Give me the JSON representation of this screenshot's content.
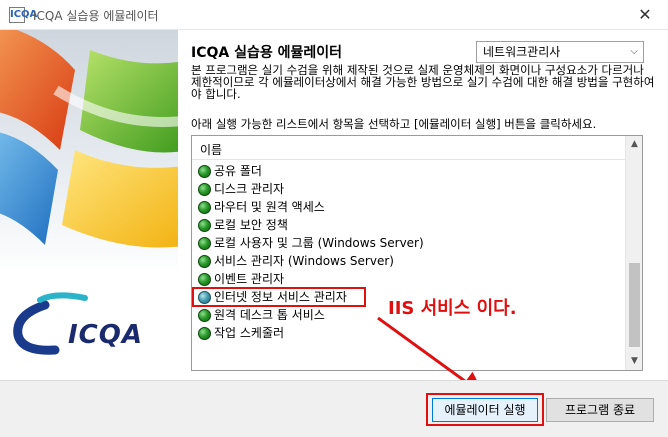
{
  "window": {
    "title": "ICQA 실습용 에뮬레이터",
    "app_icon": "ICQA",
    "close_glyph": "✕"
  },
  "brand": {
    "logo_text": "ICQA"
  },
  "header": {
    "title": "ICQA 실습용 에뮬레이터",
    "mode_select": {
      "selected": "네트워크관리사",
      "chevron": "⌵"
    }
  },
  "description": "본 프로그램은 실기 수검을 위해 제작된 것으로 실제 운영체제의 화면이나 구성요소가 다르거나 제한적이므로 각 에뮬레이터상에서 해결 가능한 방법으로 실기 수검에 대한 해결 방법을 구현하여야 합니다.",
  "instruction": "아래 실행 가능한 리스트에서 항목을 선택하고 [에뮬레이터 실행] 버튼을 클릭하세요.",
  "list": {
    "column_header": "이름",
    "items": [
      {
        "label": "공유 폴더"
      },
      {
        "label": "디스크 관리자"
      },
      {
        "label": "라우터 및 원격 액세스"
      },
      {
        "label": "로컬 보안 정책"
      },
      {
        "label": "로컬 사용자 및 그룹 (Windows Server)"
      },
      {
        "label": "서비스 관리자 (Windows Server)"
      },
      {
        "label": "이벤트 관리자"
      },
      {
        "label": "인터넷 정보 서비스 관리자"
      },
      {
        "label": "원격 데스크 톱 서비스"
      },
      {
        "label": "작업 스케줄러"
      }
    ],
    "selected_index": 7,
    "scroll_up": "▲",
    "scroll_down": "▼"
  },
  "annotation": {
    "text": "IIS 서비스 이다.",
    "color": "#e01010"
  },
  "footer": {
    "run_button": "에뮬레이터 실행",
    "exit_button": "프로그램 종료"
  }
}
